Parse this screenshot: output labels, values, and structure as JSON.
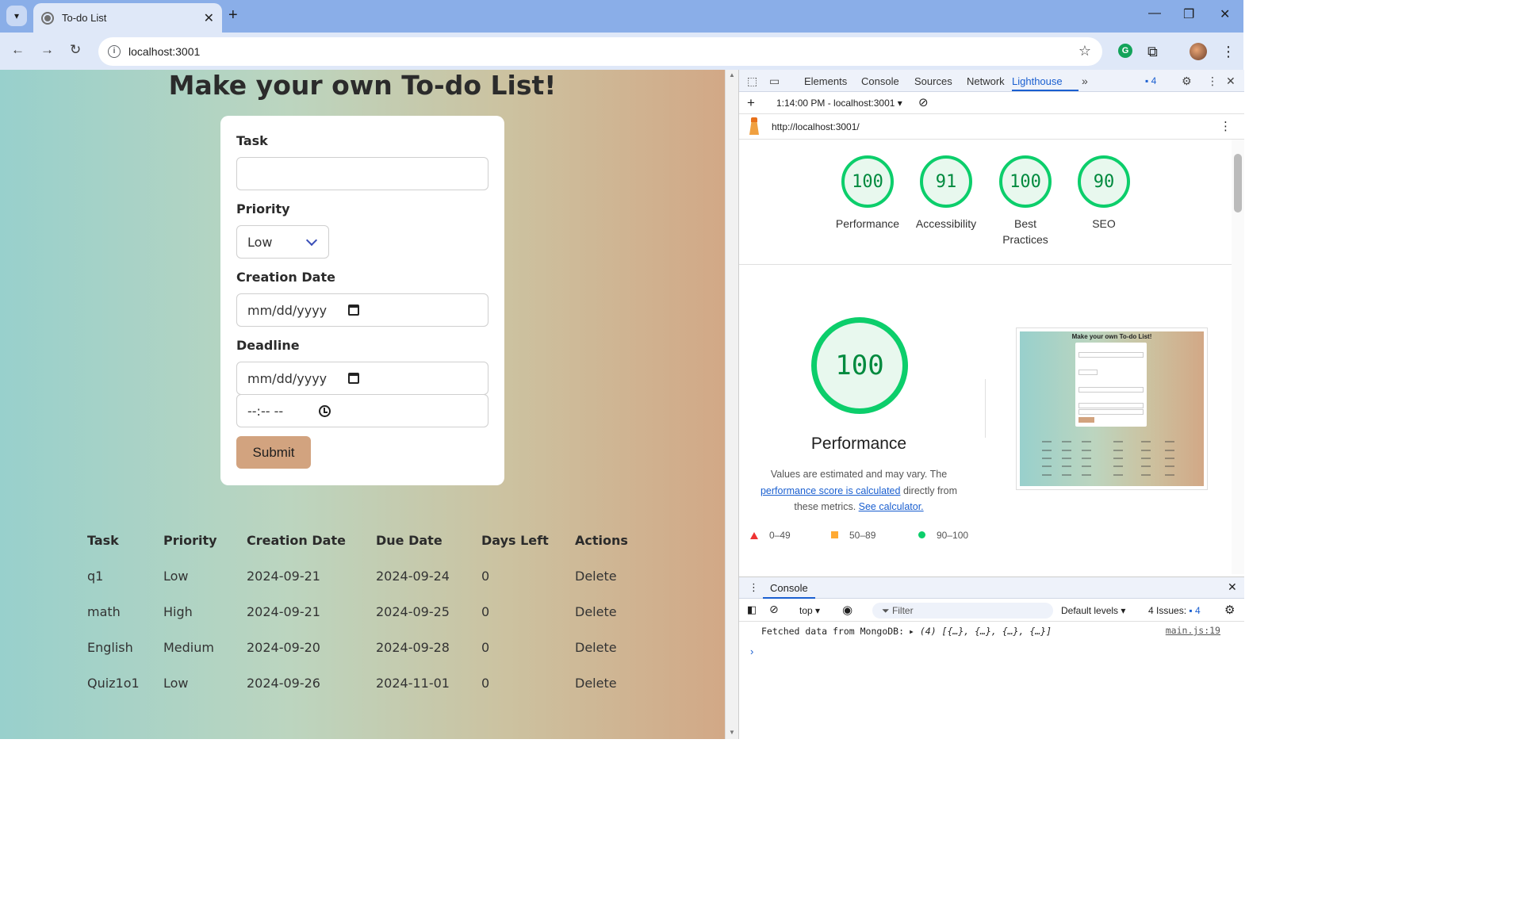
{
  "browser": {
    "tab_title": "To-do List",
    "url": "localhost:3001",
    "close_symbol": "✕",
    "new_tab_symbol": "+",
    "avatar_icon": "profile-avatar-icon"
  },
  "page": {
    "title": "Make your own To-do List!",
    "form": {
      "task_label": "Task",
      "task_value": "",
      "priority_label": "Priority",
      "priority_value": "Low",
      "creation_label": "Creation Date",
      "creation_placeholder": "mm/dd/yyyy",
      "deadline_label": "Deadline",
      "deadline_placeholder": "mm/dd/yyyy",
      "time_placeholder": "--:-- --",
      "submit_label": "Submit"
    },
    "table": {
      "headers": [
        "Task",
        "Priority",
        "Creation Date",
        "Due Date",
        "Days Left",
        "Actions"
      ],
      "rows": [
        [
          "q1",
          "Low",
          "2024-09-21",
          "2024-09-24",
          "0",
          "Delete"
        ],
        [
          "math",
          "High",
          "2024-09-21",
          "2024-09-25",
          "0",
          "Delete"
        ],
        [
          "English",
          "Medium",
          "2024-09-20",
          "2024-09-28",
          "0",
          "Delete"
        ],
        [
          "Quiz1o1",
          "Low",
          "2024-09-26",
          "2024-11-01",
          "0",
          "Delete"
        ]
      ]
    }
  },
  "devtools": {
    "tabs": [
      "Elements",
      "Console",
      "Sources",
      "Network",
      "Lighthouse"
    ],
    "active_tab": "Lighthouse",
    "issues_count": "4",
    "report_label": "1:14:00 PM - localhost:3001 ▾",
    "report_url": "http://localhost:3001/",
    "scores": [
      {
        "label": "Performance",
        "value": "100"
      },
      {
        "label": "Accessibility",
        "value": "91"
      },
      {
        "label": "Best Practices",
        "value": "100"
      },
      {
        "label": "SEO",
        "value": "90"
      }
    ],
    "perf": {
      "score": "100",
      "title": "Performance",
      "desc_prefix": "Values are estimated and may vary. The ",
      "desc_link": "performance score is calculated",
      "desc_mid": " directly from these metrics. ",
      "desc_link2": "See calculator."
    },
    "legend": [
      "0–49",
      "50–89",
      "90–100"
    ],
    "thumbnail_title": "Make your own To-do List!",
    "console": {
      "tab": "Console",
      "context": "top ▾",
      "filter_placeholder": "Filter",
      "levels": "Default levels ▾",
      "issues": "4 Issues:",
      "issues_count": "4",
      "message_text": "Fetched data from MongoDB: ",
      "message_obj": "(4) [{…}, {…}, {…}, {…}]",
      "source": "main.js:19"
    }
  },
  "colors": {
    "accent": "#1a5fd0",
    "score_green": "#0cce6b",
    "submit_bg": "#d2a37f"
  }
}
